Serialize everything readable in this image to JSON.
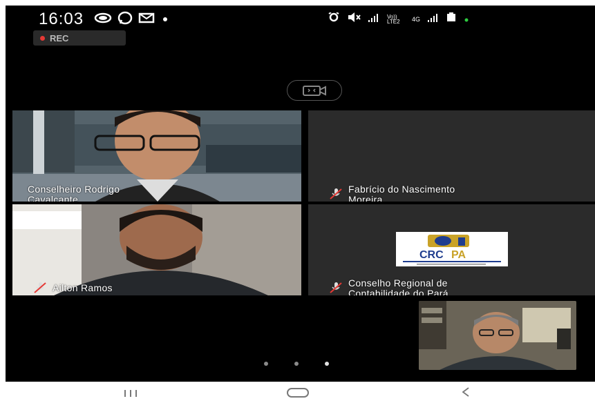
{
  "status_bar": {
    "time": "16:03",
    "left_icons": [
      "call-recording-icon",
      "whatsapp-icon",
      "email-icon",
      "dot-icon"
    ],
    "right_icons": [
      "alarm-icon",
      "mute-icon",
      "signal-icon",
      "volte-icon",
      "4g-icon",
      "signal-icon",
      "battery-icon"
    ],
    "network_label_1": "Vo)) LTE2",
    "network_label_2": "4G"
  },
  "recording": {
    "label": "REC",
    "dot_color": "#e53935"
  },
  "camera_switch": {
    "icon": "camera-switch-icon"
  },
  "participants": [
    {
      "name": "Conselheiro Rodrigo Cavalcante",
      "line1": "Conselheiro Rodrigo",
      "line2": "Cavalcante",
      "muted": false,
      "video": "man-with-glasses-video"
    },
    {
      "name": "Fabrício do Nascimento Moreira",
      "line1": "Fabrício do Nascimento",
      "line2": "Moreira",
      "muted": true,
      "video": "no-video"
    },
    {
      "name": "Ailton Ramos",
      "line1": "Ailton Ramos",
      "line2": "",
      "muted": true,
      "video": "bearded-man-video"
    },
    {
      "name": "Conselho Regional de Contabilidade do Pará",
      "line1": "Conselho Regional de",
      "line2": "Contabilidade do Pará",
      "muted": true,
      "video": "crc-pa-logo"
    }
  ],
  "crc_logo": {
    "text": "CRCPA",
    "subtitle": "CONSELHO REGIONAL DE CONTABILIDADE DO PARÁ",
    "gold": "#c9a227",
    "blue": "#1f3d8f"
  },
  "self_view": {
    "video": "older-man-video"
  },
  "pagination": {
    "count": 3,
    "active": 3
  },
  "nav_bar": {
    "recents_icon": "recents-icon",
    "home_icon": "home-icon",
    "back_icon": "back-icon"
  }
}
